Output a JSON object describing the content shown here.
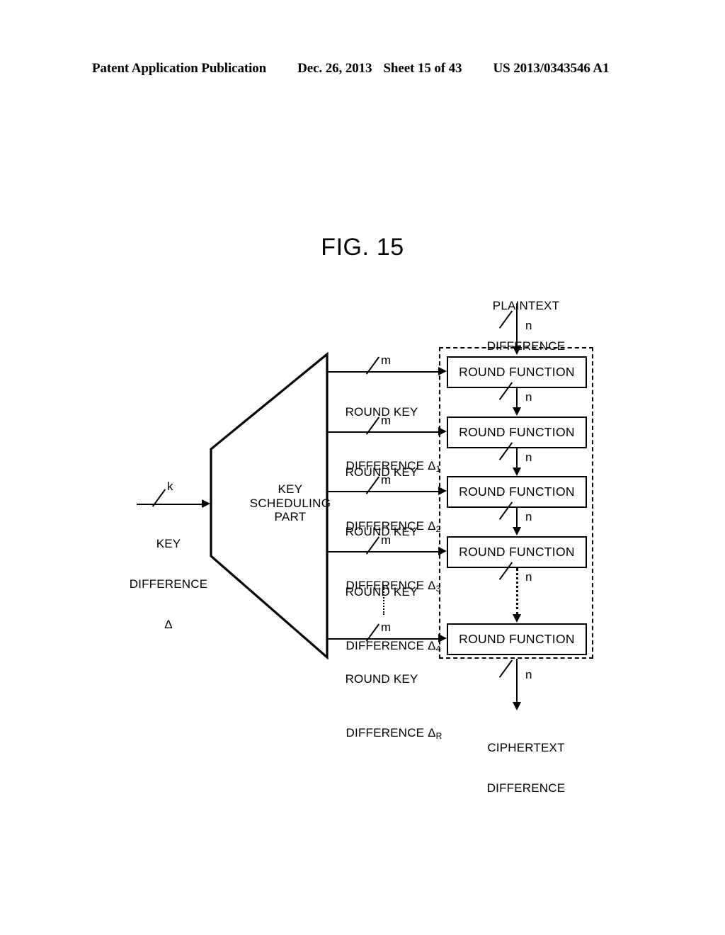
{
  "header": {
    "publication": "Patent Application Publication",
    "date": "Dec. 26, 2013",
    "sheet": "Sheet 15 of 43",
    "patent_number": "US 2013/0343546 A1"
  },
  "figure": {
    "label": "FIG.",
    "number": "15"
  },
  "diagram": {
    "plaintext_input": {
      "label_line1": "PLAINTEXT",
      "label_line2": "DIFFERENCE",
      "bit_width": "n"
    },
    "ciphertext_output": {
      "label_line1": "CIPHERTEXT",
      "label_line2": "DIFFERENCE",
      "bit_width": "n"
    },
    "key_input": {
      "bit_width": "k",
      "label_line1": "KEY",
      "label_line2": "DIFFERENCE",
      "symbol": "Δ"
    },
    "key_scheduling_part": {
      "line1": "KEY",
      "line2": "SCHEDULING",
      "line3": "PART"
    },
    "round_key_bit_width": "m",
    "round_keys": [
      {
        "line1": "ROUND KEY",
        "line2": "DIFFERENCE Δ",
        "subscript": "1"
      },
      {
        "line1": "ROUND KEY",
        "line2": "DIFFERENCE Δ",
        "subscript": "2"
      },
      {
        "line1": "ROUND KEY",
        "line2": "DIFFERENCE Δ",
        "subscript": "3"
      },
      {
        "line1": "ROUND KEY",
        "line2": "DIFFERENCE Δ",
        "subscript": "4"
      },
      {
        "line1": "ROUND KEY",
        "line2": "DIFFERENCE Δ",
        "subscript": "R"
      }
    ],
    "round_functions": [
      {
        "label": "ROUND FUNCTION"
      },
      {
        "label": "ROUND FUNCTION"
      },
      {
        "label": "ROUND FUNCTION"
      },
      {
        "label": "ROUND FUNCTION"
      },
      {
        "label": "ROUND FUNCTION"
      }
    ],
    "interstage_bit_widths": [
      "n",
      "n",
      "n",
      "n"
    ],
    "colors": {
      "ink": "#000000",
      "paper": "#ffffff"
    }
  }
}
